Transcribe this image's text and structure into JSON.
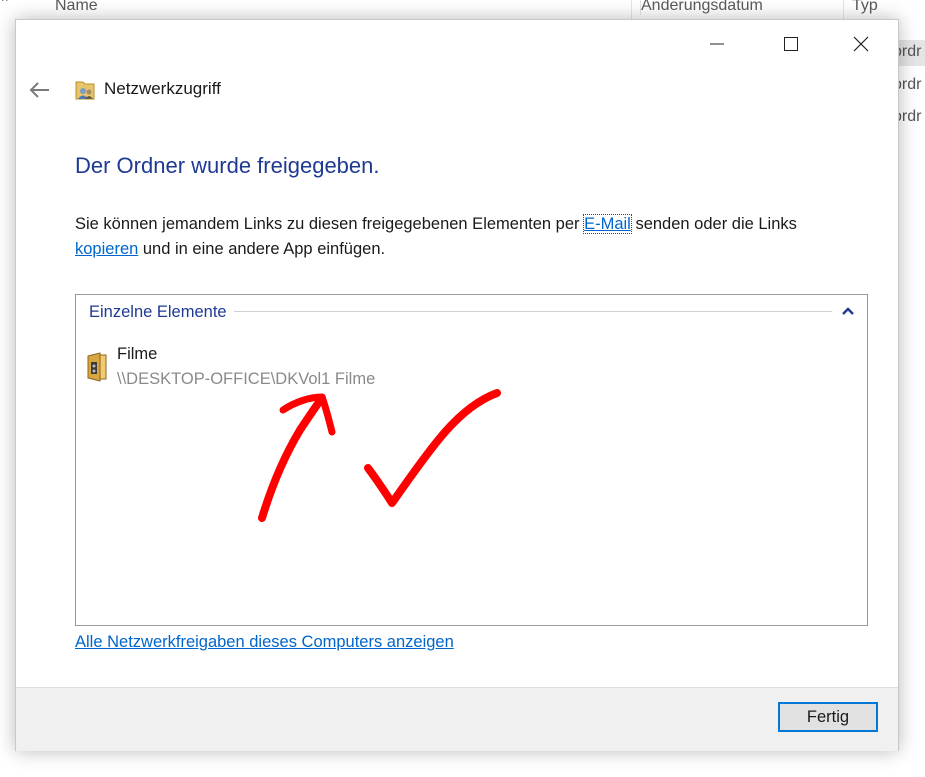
{
  "explorer": {
    "columns": [
      "Name",
      "Änderungsdatum",
      "Typ"
    ],
    "row_fragments": [
      "ordr",
      "ordr",
      "ordr"
    ]
  },
  "dialog": {
    "title": "Netzwerkzugriff",
    "heading": "Der Ordner wurde freigegeben.",
    "paragraph": {
      "part1": "Sie können jemandem Links zu diesen freigegebenen Elementen per ",
      "email_link": "E-Mail",
      "part2": " senden oder die Links ",
      "copy_link": "kopieren",
      "part3": " und in eine andere App einfügen."
    },
    "group": {
      "title": "Einzelne Elemente",
      "items": [
        {
          "name": "Filme",
          "path": "\\\\DESKTOP-OFFICE\\DKVol1 Filme"
        }
      ]
    },
    "all_shares_link": "Alle Netzwerkfreigaben dieses Computers anzeigen",
    "done_button": "Fertig"
  },
  "icons": {
    "back": "back-arrow-icon",
    "wizard": "network-share-icon",
    "chevron": "chevron-up-icon",
    "folder": "shared-folder-icon",
    "minimize": "minimize-icon",
    "maximize": "maximize-icon",
    "close": "close-icon"
  },
  "colors": {
    "heading": "#1f3a93",
    "link": "#0066cc",
    "accent": "#0078d7",
    "annotation": "#ff0000"
  }
}
